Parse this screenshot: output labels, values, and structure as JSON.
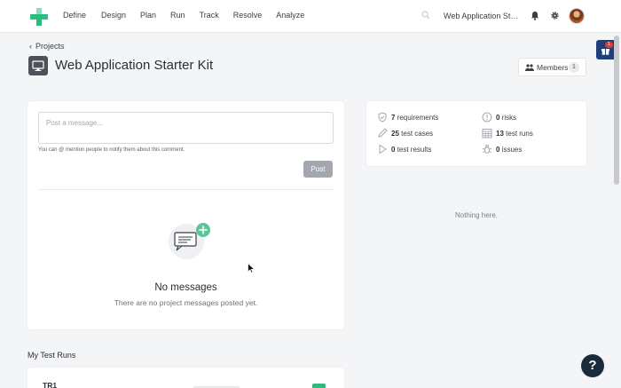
{
  "nav": {
    "items": [
      "Define",
      "Design",
      "Plan",
      "Run",
      "Track",
      "Resolve",
      "Analyze"
    ],
    "project_switcher": "Web Application Star...",
    "icons": [
      "logo-cross-icon",
      "search-icon",
      "bell-icon",
      "gear-icon",
      "avatar"
    ]
  },
  "gift_badge": "1",
  "header": {
    "back_label": "Projects",
    "title": "Web Application Starter Kit",
    "members_label": "Members",
    "members_count": "1"
  },
  "messages": {
    "placeholder": "Post a message...",
    "hint": "You can @ mention people to notify them about this comment.",
    "post_label": "Post",
    "empty_title": "No messages",
    "empty_subtitle": "There are no project messages posted yet."
  },
  "stats": {
    "requirements": {
      "count": "7",
      "label": "requirements"
    },
    "risks": {
      "count": "0",
      "label": "risks"
    },
    "test_cases": {
      "count": "25",
      "label": "test cases"
    },
    "test_runs": {
      "count": "13",
      "label": "test runs"
    },
    "test_results": {
      "count": "0",
      "label": "test results"
    },
    "issues": {
      "count": "0",
      "label": "issues"
    }
  },
  "activity_empty": "Nothing here.",
  "test_runs": {
    "section_title": "My Test Runs",
    "rows": [
      {
        "name": "TR1"
      }
    ]
  },
  "help_label": "?",
  "colors": {
    "accent_green": "#2dbb7f",
    "post_button": "#a3a8ae",
    "help_button": "#1b2b3c",
    "gift_widget": "#1f3f7a"
  }
}
